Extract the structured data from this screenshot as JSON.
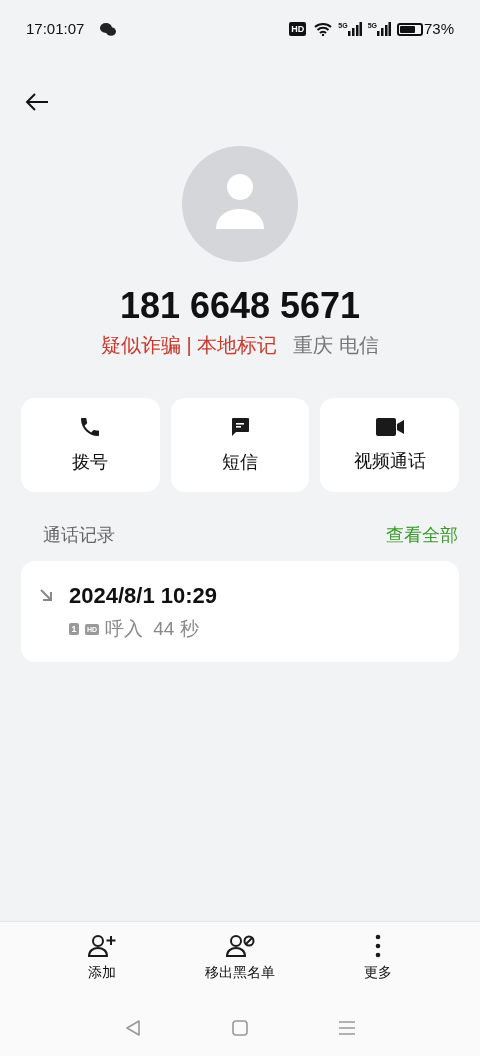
{
  "status_bar": {
    "time": "17:01:07",
    "hd": "HD",
    "signals": [
      "5G",
      "5G"
    ],
    "battery": "73%"
  },
  "contact": {
    "number": "181 6648 5671",
    "tag": "疑似诈骗 | 本地标记",
    "location": "重庆 电信"
  },
  "actions": [
    {
      "kind": "call",
      "label": "拨号"
    },
    {
      "kind": "sms",
      "label": "短信"
    },
    {
      "kind": "video",
      "label": "视频通话"
    }
  ],
  "call_log": {
    "title": "通话记录",
    "view_all": "查看全部",
    "entries": [
      {
        "kind": "incoming",
        "time": "2024/8/1 10:29",
        "sim": "1",
        "hd": "HD",
        "type": "呼入",
        "duration": "44 秒"
      }
    ]
  },
  "bottom_actions": [
    {
      "kind": "add",
      "label": "添加"
    },
    {
      "kind": "unblock",
      "label": "移出黑名单"
    },
    {
      "kind": "more",
      "label": "更多"
    }
  ]
}
